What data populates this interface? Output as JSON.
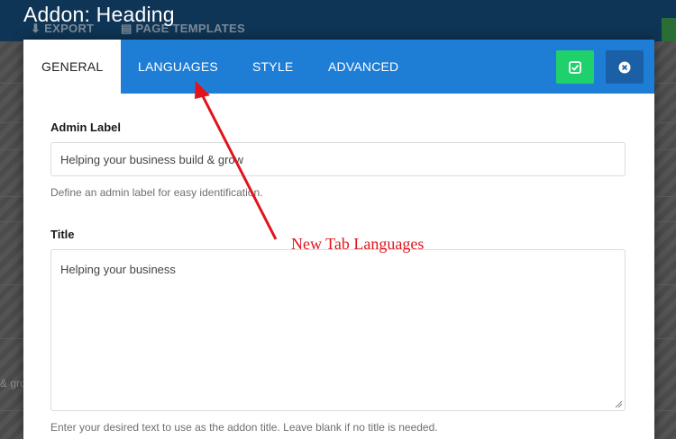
{
  "window": {
    "title": "Addon: Heading"
  },
  "background": {
    "toolbar": [
      {
        "label": "EXPORT",
        "icon": "download-icon"
      },
      {
        "label": "PAGE TEMPLATES",
        "icon": "template-icon"
      }
    ],
    "partial_text": "& gro"
  },
  "modal": {
    "tabs": [
      {
        "label": "GENERAL",
        "active": true
      },
      {
        "label": "LANGUAGES",
        "active": false
      },
      {
        "label": "STYLE",
        "active": false
      },
      {
        "label": "ADVANCED",
        "active": false
      }
    ],
    "buttons": {
      "save_icon": "check-square-icon",
      "close_icon": "close-circle-icon"
    },
    "fields": {
      "admin_label": {
        "label": "Admin Label",
        "value": "Helping your business build & grow",
        "help": "Define an admin label for easy identification."
      },
      "title": {
        "label": "Title",
        "value": "Helping your business",
        "help": "Enter your desired text to use as the addon title. Leave blank if no title is needed."
      }
    }
  },
  "annotation": {
    "text": "New Tab Languages",
    "color": "#e0141c"
  },
  "colors": {
    "tabbar": "#1e7ed6",
    "save_button": "#1fd16b",
    "close_button": "#1b5fa6",
    "overlay_topbar": "#0f3556"
  }
}
